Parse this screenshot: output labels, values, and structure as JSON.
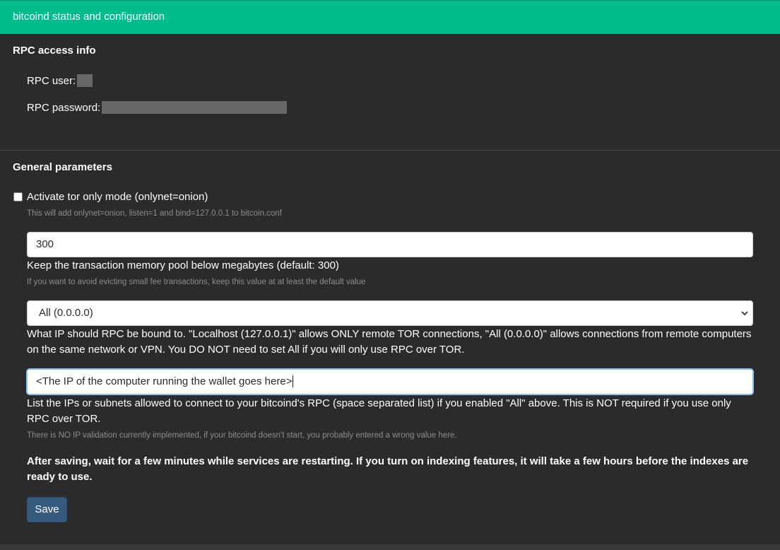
{
  "header": {
    "title": "bitcoind status and configuration"
  },
  "rpc": {
    "section_title": "RPC access info",
    "user_label": "RPC user:",
    "password_label": "RPC password:"
  },
  "general": {
    "section_title": "General parameters",
    "tor_checkbox": {
      "label": "Activate tor only mode (onlynet=onion)",
      "checked": false,
      "help": "This will add onlynet=onion, listen=1 and bind=127.0.0.1 to bitcoin.conf"
    },
    "mempool": {
      "value": "300",
      "label": "Keep the transaction memory pool below megabytes (default: 300)",
      "help": "If you want to avoid evicting small fee transactions, keep this value at at least the default value"
    },
    "rpc_bind": {
      "selected": "All (0.0.0.0)",
      "description": "What IP should RPC be bound to. \"Localhost (127.0.0.1)\" allows ONLY remote TOR connections, \"All (0.0.0.0)\" allows connections from remote computers on the same network or VPN. You DO NOT need to set All if you will only use RPC over TOR."
    },
    "allowed_ips": {
      "value": "<The IP of the computer running the wallet goes here>",
      "description": "List the IPs or subnets allowed to connect to your bitcoind's RPC (space separated list) if you enabled \"All\" above. This is NOT required if you use only RPC over TOR.",
      "help": "There is NO IP validation currently implemented, if your bitcoind doesn't start, you probably entered a wrong value here."
    },
    "notice": "After saving, wait for a few minutes while services are restarting. If you turn on indexing features, it will take a few hours before the indexes are ready to use.",
    "save_label": "Save"
  },
  "colors": {
    "header": "#00bb8c",
    "background": "#2b2b2b",
    "button": "#375a7f"
  }
}
